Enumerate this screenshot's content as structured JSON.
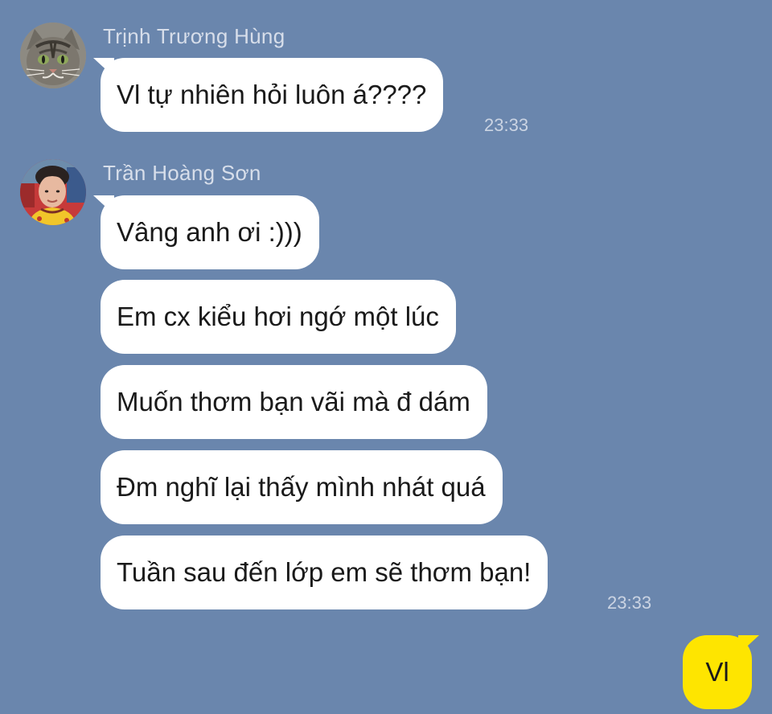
{
  "theme": {
    "background": "#6a86ad",
    "incoming_bubble": "#ffffff",
    "outgoing_bubble": "#fee500"
  },
  "messages": {
    "group1": {
      "sender": "Trịnh Trương Hùng",
      "avatar_icon": "cat-avatar",
      "bubbles": [
        "Vl tự nhiên hỏi luôn á????"
      ],
      "time": "23:33"
    },
    "group2": {
      "sender": "Trần Hoàng Sơn",
      "avatar_icon": "person-avatar",
      "bubbles": [
        "Vâng anh ơi :)))",
        "Em cx kiểu hơi ngớ một lúc",
        "Muốn thơm bạn vãi mà đ dám",
        "Đm nghĩ lại thấy mình nhát quá",
        "Tuần sau đến lớp em sẽ thơm bạn!"
      ],
      "time": "23:33"
    },
    "outgoing": {
      "text": "Vl"
    }
  }
}
